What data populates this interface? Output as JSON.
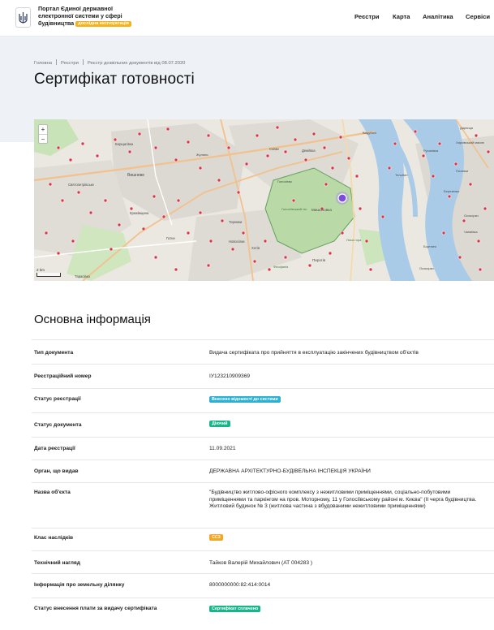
{
  "header": {
    "brand_line1": "Портал Єдиної державної",
    "brand_line2": "електронної системи у сфері",
    "brand_line3": "будівництва",
    "beta_label": "дослідна експлуатація",
    "nav": [
      "Реєстри",
      "Карта",
      "Аналітика",
      "Сервіси"
    ]
  },
  "breadcrumbs": [
    "Головна",
    "Реєстри",
    "Реєстр дозвільних документів від 08.07.2020"
  ],
  "page_title": "Сертифікат готовності",
  "map": {
    "zoom_in": "+",
    "zoom_out": "−",
    "scale_label": "2 km",
    "labels": [
      "Вишневе",
      "Святопетрівське",
      "Крюківщина",
      "Гатне",
      "Тарасівка",
      "Теремки",
      "Голосіївський ліс",
      "Мишоловка",
      "Пирогів",
      "Бортничі",
      "Осокорки",
      "Березняки",
      "Русанівка",
      "Тельбин",
      "Дарниця",
      "Видубичі",
      "Деміївка",
      "Совки",
      "Новосілки",
      "Хотів",
      "Феофанія",
      "Борщагівка",
      "Лиса гора",
      "Харківський масив",
      "Позняки",
      "Чапаївка",
      "Осокорки",
      "Голосієво",
      "Жуляни"
    ]
  },
  "info": {
    "section_title": "Основна інформація",
    "rows": [
      {
        "key": "Тип документа",
        "value": "Видача сертифіката про прийняття в експлуатацію закінчених будівництвом об'єктів"
      },
      {
        "key": "Реєстраційний номер",
        "value": "ІУ123210909369"
      },
      {
        "key": "Статус реєстрації",
        "badge": "Внесено відомості до системи",
        "badge_color": "#2bb0d6"
      },
      {
        "key": "Статус документа",
        "badge": "Діючий",
        "badge_color": "#18b48a"
      },
      {
        "key": "Дата реєстрації",
        "value": "11.09.2021"
      },
      {
        "key": "Орган, що видав",
        "value": "ДЕРЖАВНА АРХІТЕКТУРНО-БУДІВЕЛЬНА ІНСПЕКЦІЯ УКРАЇНИ"
      },
      {
        "key": "Назва об'єкта",
        "value": "\"Будівництво житлово-офісного комплексу з нежитловими приміщеннями, соціально-побутовими приміщеннями та паркінгом на пров. Моторному, 11 у Голосіївському районі м. Києва\" (ІІ черга будівництва. Житловий будинок № 3 (житлова частина з вбудованими нежитловими приміщеннями)"
      },
      {
        "key": "Клас наслідків",
        "badge": "СС3",
        "badge_color": "#f5a623"
      },
      {
        "key": "Технічний нагляд",
        "value": "Тайков Валерій Михайлович (АТ 004283 )"
      },
      {
        "key": "Інформація про земельну ділянку",
        "value": "8000000000:82:414:0014"
      },
      {
        "key": "Статус внесення плати за видачу сертифіката",
        "badge": "Сертифікат сплачено",
        "badge_color": "#18b48a"
      }
    ]
  }
}
